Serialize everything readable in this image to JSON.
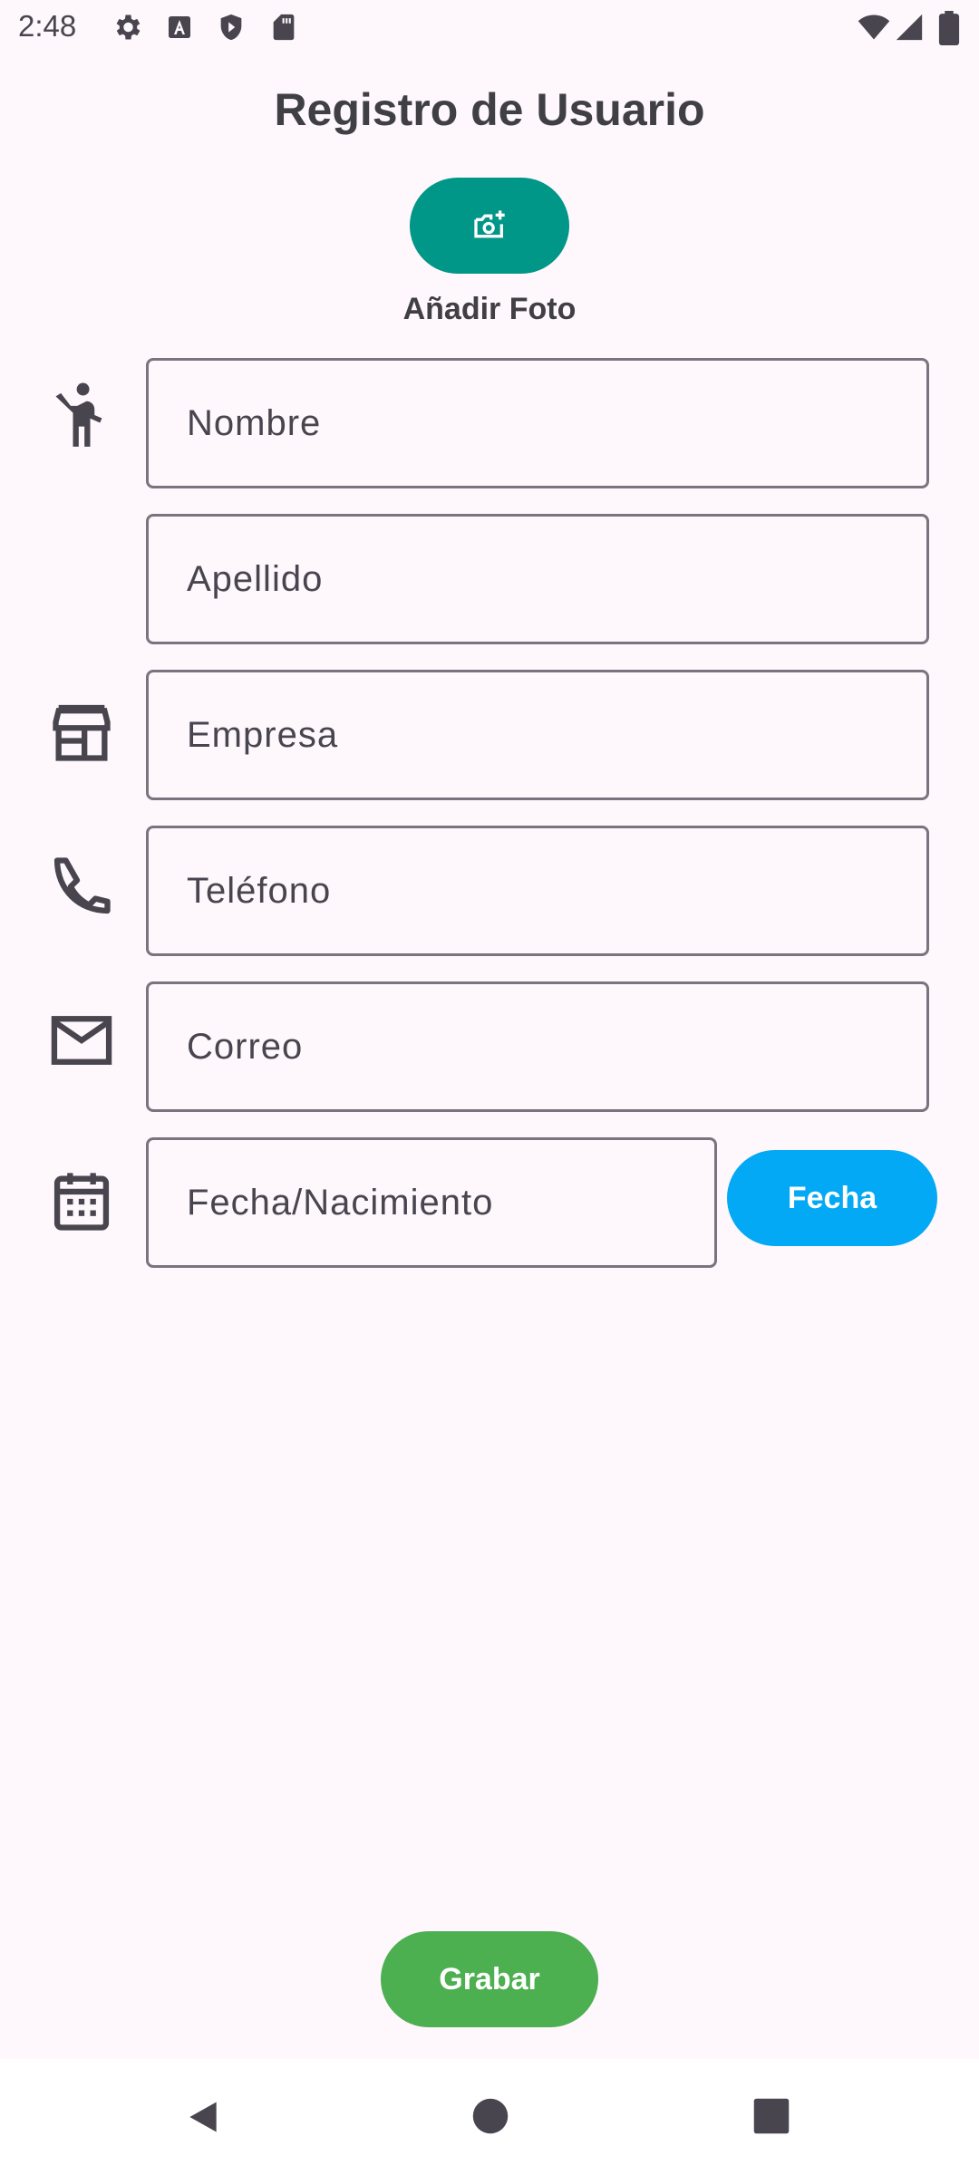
{
  "status_bar": {
    "time": "2:48",
    "left_icons": [
      "gear-icon",
      "a-badge-icon",
      "shield-icon",
      "sd-card-icon"
    ],
    "right_icons": [
      "wifi-icon",
      "signal-icon",
      "battery-icon"
    ]
  },
  "header": {
    "title": "Registro de Usuario"
  },
  "photo": {
    "icon": "add-photo-icon",
    "label": "Añadir Foto"
  },
  "form": {
    "nombre": {
      "placeholder": "Nombre",
      "icon": "person-icon"
    },
    "apellido": {
      "placeholder": "Apellido"
    },
    "empresa": {
      "placeholder": "Empresa",
      "icon": "store-icon"
    },
    "telefono": {
      "placeholder": "Teléfono",
      "icon": "phone-icon"
    },
    "correo": {
      "placeholder": "Correo",
      "icon": "mail-icon"
    },
    "fecha": {
      "placeholder": "Fecha/Nacimiento",
      "icon": "calendar-icon"
    }
  },
  "buttons": {
    "fecha": "Fecha",
    "grabar": "Grabar"
  },
  "colors": {
    "background": "#FEF7FC",
    "photo_button": "#009688",
    "fecha_button": "#03A9F4",
    "grabar_button": "#4CAF50",
    "field_border": "#79747E"
  },
  "nav": {
    "items": [
      "back-icon",
      "home-icon",
      "recents-icon"
    ]
  }
}
